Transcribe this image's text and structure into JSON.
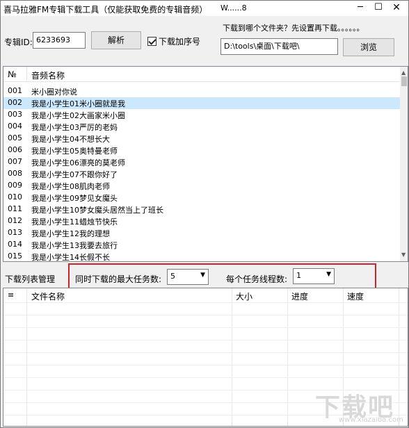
{
  "window": {
    "title": "喜马拉雅FM专辑下载工具（仅能获取免费的专辑音频）",
    "title_suffix": "W......8",
    "minimize": "─",
    "maximize": "☐",
    "close": "✕"
  },
  "top": {
    "album_id_label": "专辑ID:",
    "album_id_value": "6233693",
    "parse_button": "解析",
    "add_number_checkbox_label": "下载加序号",
    "add_number_checked": true,
    "folder_prompt": "下载到哪个文件夹？先设置再下载。。。。。。",
    "folder_path": "D:\\tools\\桌面\\下载吧\\",
    "browse_button": "浏览"
  },
  "audio_list": {
    "columns": {
      "number": "№",
      "name": "音频名称"
    },
    "selected_index": 1,
    "rows": [
      {
        "no": "001",
        "title": "米小圈对你说"
      },
      {
        "no": "002",
        "title": "我是小学生01米小圈就是我"
      },
      {
        "no": "003",
        "title": "我是小学生02大画家米小圈"
      },
      {
        "no": "004",
        "title": "我是小学生03严厉的老妈"
      },
      {
        "no": "005",
        "title": "我是小学生04不想长大"
      },
      {
        "no": "006",
        "title": "我是小学生05奥特曼老师"
      },
      {
        "no": "007",
        "title": "我是小学生06漂亮的莫老师"
      },
      {
        "no": "008",
        "title": "我是小学生07不跟你好了"
      },
      {
        "no": "009",
        "title": "我是小学生08肌肉老师"
      },
      {
        "no": "010",
        "title": "我是小学生09梦见女魔头"
      },
      {
        "no": "011",
        "title": "我是小学生10梦女魔头居然当上了班长"
      },
      {
        "no": "012",
        "title": "我是小学生11蜡烛节快乐"
      },
      {
        "no": "013",
        "title": "我是小学生12我的理想"
      },
      {
        "no": "014",
        "title": "我是小学生13我要去旅行"
      },
      {
        "no": "015",
        "title": "我是小学生14长假不长"
      }
    ]
  },
  "download_manager": {
    "section_label": "下载列表管理",
    "max_tasks_label": "同时下载的最大任务数:",
    "max_tasks_value": "5",
    "threads_label": "每个任务线程数:",
    "threads_value": "1",
    "highlight_color": "#c8252c"
  },
  "download_list": {
    "columns": {
      "icon": "≡",
      "file": "文件名称",
      "size": "大小",
      "progress": "进度",
      "speed": "速度"
    }
  },
  "watermark": {
    "text": "下载吧",
    "url": "www.xiazaiba.com"
  }
}
